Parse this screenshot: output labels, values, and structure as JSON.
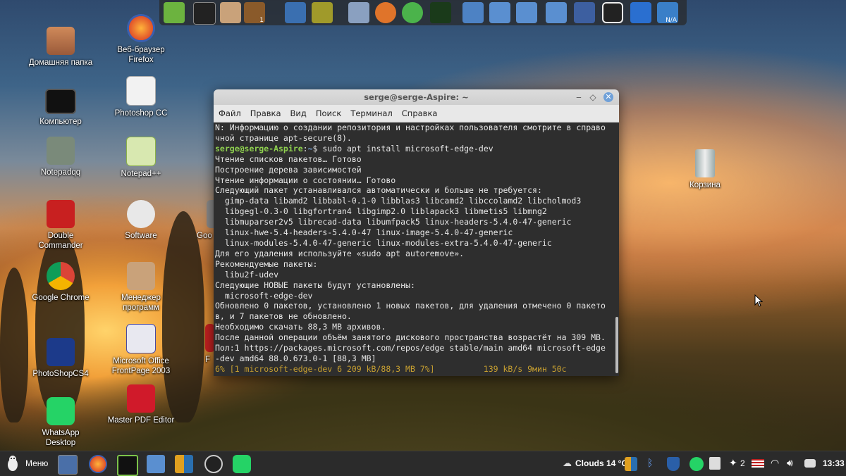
{
  "desktop_icons": [
    {
      "label": "Домашняя папка"
    },
    {
      "label": "Веб-браузер\nFirefox"
    },
    {
      "label": "Компьютер"
    },
    {
      "label": "Photoshop CC"
    },
    {
      "label": "Notepadqq"
    },
    {
      "label": "Notepad++"
    },
    {
      "label": "Double\nCommander"
    },
    {
      "label": "Software"
    },
    {
      "label": "Goo"
    },
    {
      "label": "Google Chrome"
    },
    {
      "label": "Менеджер\nпрограмм"
    },
    {
      "label": "PhotoShopCS4"
    },
    {
      "label": "Microsoft Office\nFrontPage 2003"
    },
    {
      "label": "WhatsApp\nDesktop"
    },
    {
      "label": "Master PDF Editor"
    },
    {
      "label": "F"
    },
    {
      "label": "Корзина"
    }
  ],
  "dock": {
    "badge": "1",
    "na_label": "N/A"
  },
  "window": {
    "title": "serge@serge-Aspire: ~",
    "minimize": "‒",
    "maximize": "◇",
    "close": "✕",
    "menu": [
      "Файл",
      "Правка",
      "Вид",
      "Поиск",
      "Терминал",
      "Справка"
    ]
  },
  "terminal": {
    "lines_before": [
      "N: Информацию о создании репозитория и настройках пользователя смотрите в справо",
      "чной странице apt-secure(8)."
    ],
    "prompt_user": "serge@serge-Aspire",
    "prompt_sep": ":",
    "prompt_path": "~",
    "prompt_cmd": "$ sudo apt install microsoft-edge-dev",
    "lines_after": [
      "Чтение списков пакетов… Готово",
      "Построение дерева зависимостей",
      "Чтение информации о состоянии… Готово",
      "Следующий пакет устанавливался автоматически и больше не требуется:",
      "  gimp-data libamd2 libbabl-0.1-0 libblas3 libcamd2 libccolamd2 libcholmod3",
      "  libgegl-0.3-0 libgfortran4 libgimp2.0 liblapack3 libmetis5 libmng2",
      "  libmuparser2v5 librecad-data libumfpack5 linux-headers-5.4.0-47-generic",
      "  linux-hwe-5.4-headers-5.4.0-47 linux-image-5.4.0-47-generic",
      "  linux-modules-5.4.0-47-generic linux-modules-extra-5.4.0-47-generic",
      "Для его удаления используйте «sudo apt autoremove».",
      "Рекомендуемые пакеты:",
      "  libu2f-udev",
      "Следующие НОВЫЕ пакеты будут установлены:",
      "  microsoft-edge-dev",
      "Обновлено 0 пакетов, установлено 1 новых пакетов, для удаления отмечено 0 пакето",
      "в, и 7 пакетов не обновлено.",
      "Необходимо скачать 88,3 MB архивов.",
      "После данной операции объём занятого дискового пространства возрастёт на 309 MB.",
      "Пол:1 https://packages.microsoft.com/repos/edge stable/main amd64 microsoft-edge",
      "-dev amd64 88.0.673.0-1 [88,3 MB]"
    ],
    "progress_line": "6% [1 microsoft-edge-dev 6 209 kB/88,3 MB 7%]          139 kB/s 9мин 50с"
  },
  "taskbar": {
    "menu_label": "Меню",
    "weather": "Clouds 14 °C",
    "notif_count": "2",
    "clock": "13:33"
  }
}
